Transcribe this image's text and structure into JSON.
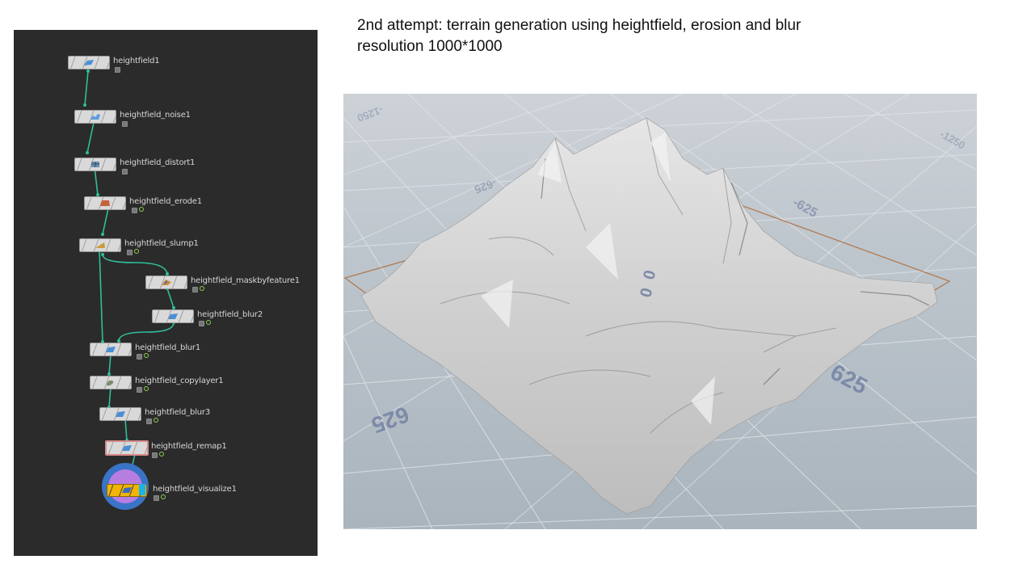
{
  "caption": {
    "line1": "2nd attempt: terrain generation using heightfield, erosion and blur",
    "line2": "resolution 1000*1000"
  },
  "network": {
    "nodes": [
      {
        "label": "heightfield1",
        "icon": "heightfield-icon"
      },
      {
        "label": "heightfield_noise1",
        "icon": "noise-icon"
      },
      {
        "label": "heightfield_distort1",
        "icon": "distort-icon"
      },
      {
        "label": "heightfield_erode1",
        "icon": "erode-icon"
      },
      {
        "label": "heightfield_slump1",
        "icon": "slump-icon"
      },
      {
        "label": "heightfield_maskbyfeature1",
        "icon": "maskbyfeature-icon"
      },
      {
        "label": "heightfield_blur2",
        "icon": "blur-icon"
      },
      {
        "label": "heightfield_blur1",
        "icon": "blur-icon"
      },
      {
        "label": "heightfield_copylayer1",
        "icon": "copylayer-icon"
      },
      {
        "label": "heightfield_blur3",
        "icon": "blur-icon"
      },
      {
        "label": "heightfield_remap1",
        "icon": "remap-icon"
      },
      {
        "label": "heightfield_visualize1",
        "icon": "visualize-icon"
      }
    ],
    "display_flag_color": "#19b5e9",
    "wire_color": "#2fbf9a"
  },
  "viewport": {
    "grid_labels": {
      "left_near": "625",
      "right_near": "625",
      "center_a": "0",
      "center_b": "0",
      "mid_left": "-625",
      "mid_right": "-625",
      "far_left": "-1250",
      "far_right": "-1250"
    },
    "bounds_color": "#b07a52",
    "terrain_color": "#d4d4d4"
  }
}
